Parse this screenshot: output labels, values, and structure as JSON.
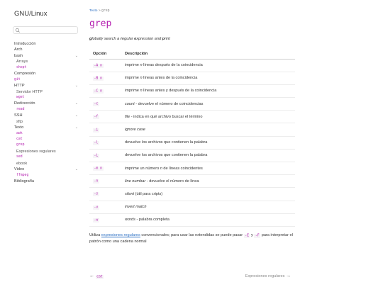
{
  "sidebar": {
    "title": "GNU/Linux",
    "search_placeholder": "",
    "items": [
      {
        "label": "Introducción",
        "kind": "top",
        "chev": ""
      },
      {
        "label": "Arch",
        "kind": "top",
        "chev": ""
      },
      {
        "label": "bash",
        "kind": "top",
        "chev": "⌄"
      },
      {
        "label": "Arrays",
        "kind": "sub",
        "chev": ""
      },
      {
        "label": "shopt",
        "kind": "code",
        "chev": ""
      },
      {
        "label": "Compresión",
        "kind": "top",
        "chev": ""
      },
      {
        "label": "git",
        "kind": "codetop",
        "chev": ""
      },
      {
        "label": "HTTP",
        "kind": "top",
        "chev": "⌄"
      },
      {
        "label": "Servidor HTTP",
        "kind": "sub",
        "chev": ""
      },
      {
        "label": "wget",
        "kind": "code",
        "chev": ""
      },
      {
        "label": "Redirección",
        "kind": "top",
        "chev": "⌄"
      },
      {
        "label": "read",
        "kind": "code",
        "chev": ""
      },
      {
        "label": "SSH",
        "kind": "top",
        "chev": "⌄"
      },
      {
        "label": "sftp",
        "kind": "sub",
        "chev": ""
      },
      {
        "label": "Texto",
        "kind": "top",
        "chev": "⌄"
      },
      {
        "label": "awk",
        "kind": "code",
        "chev": ""
      },
      {
        "label": "cat",
        "kind": "code",
        "chev": ""
      },
      {
        "label": "grep",
        "kind": "code",
        "chev": ""
      },
      {
        "label": "Expresiones regulares",
        "kind": "sub",
        "chev": ""
      },
      {
        "label": "sed",
        "kind": "code",
        "chev": ""
      },
      {
        "label": "ebook",
        "kind": "sub",
        "chev": ""
      },
      {
        "label": "Video",
        "kind": "top",
        "chev": "⌄"
      },
      {
        "label": "ffmpeg",
        "kind": "code",
        "chev": ""
      },
      {
        "label": "Bibliografía",
        "kind": "top",
        "chev": ""
      }
    ]
  },
  "breadcrumb": {
    "section": "Texto",
    "sep": ">",
    "current": "grep"
  },
  "page": {
    "title": "grep",
    "subtitle": [
      {
        "t": "g",
        "b": true
      },
      {
        "t": "lobally search a ",
        "b": false
      },
      {
        "t": "r",
        "b": true
      },
      {
        "t": "egular ",
        "b": false
      },
      {
        "t": "e",
        "b": true
      },
      {
        "t": "xpression and ",
        "b": false
      },
      {
        "t": "p",
        "b": true
      },
      {
        "t": "rint",
        "b": false
      }
    ]
  },
  "table": {
    "headers": [
      "Opción",
      "Descripción"
    ],
    "rows": [
      {
        "opt": "-A n",
        "desc": [
          {
            "t": "imprime ",
            "i": false
          },
          {
            "t": "n",
            "i": true
          },
          {
            "t": " líneas después de la coincidencia",
            "i": false
          }
        ]
      },
      {
        "opt": "-B n",
        "desc": [
          {
            "t": "imprime ",
            "i": false
          },
          {
            "t": "n",
            "i": true
          },
          {
            "t": " líneas antes de la coincidencia",
            "i": false
          }
        ]
      },
      {
        "opt": "-C n",
        "desc": [
          {
            "t": "imprime ",
            "i": false
          },
          {
            "t": "n",
            "i": true
          },
          {
            "t": " líneas antes y después de la coincidencia",
            "i": false
          }
        ]
      },
      {
        "opt": "-c",
        "desc": [
          {
            "t": "count",
            "i": true
          },
          {
            "t": " - devuelve el número de coincidencias",
            "i": false
          }
        ]
      },
      {
        "opt": "-f",
        "desc": [
          {
            "t": "file",
            "i": true
          },
          {
            "t": " - indica en qué archivo buscar el término",
            "i": false
          }
        ]
      },
      {
        "opt": "-i",
        "desc": [
          {
            "t": "ignore case",
            "i": true
          }
        ]
      },
      {
        "opt": "-l",
        "desc": [
          {
            "t": "devuelve los archivos que contienen la palabra",
            "i": false
          }
        ]
      },
      {
        "opt": "-L",
        "desc": [
          {
            "t": "devuelve los archivos que contienen la palabra",
            "i": false
          }
        ]
      },
      {
        "opt": "-m n",
        "desc": [
          {
            "t": "imprime un número ",
            "i": false
          },
          {
            "t": "n",
            "i": true
          },
          {
            "t": " de líneas coincidentes",
            "i": false
          }
        ]
      },
      {
        "opt": "-n",
        "desc": [
          {
            "t": "line numbar",
            "i": true
          },
          {
            "t": " - devuelve el número de línea",
            "i": false
          }
        ]
      },
      {
        "opt": "-s",
        "desc": [
          {
            "t": "silent",
            "i": true
          },
          {
            "t": " (útil para cripts)",
            "i": false
          }
        ]
      },
      {
        "opt": "-v",
        "desc": [
          {
            "t": "invert match",
            "i": true
          }
        ]
      },
      {
        "opt": "-w",
        "desc": [
          {
            "t": "words",
            "i": true
          },
          {
            "t": " - palabra completa",
            "i": false
          }
        ]
      }
    ]
  },
  "note": {
    "before": "Utiliza ",
    "link": "expresiones regulares",
    "middle": " convencionales; para usar las extendidas se puede pasar ",
    "code1": "-E",
    "or": " y ",
    "code2": "-F",
    "after": " para interpretar el patrón como una cadena normal"
  },
  "footer": {
    "prev": "cat",
    "next": "Expresiones regulares"
  }
}
